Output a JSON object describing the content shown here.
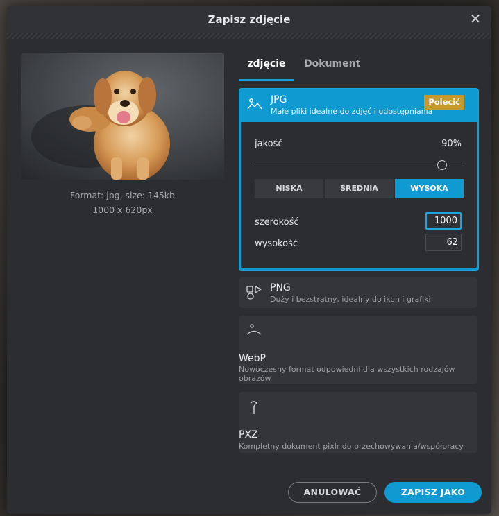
{
  "dialog": {
    "title": "Zapisz zdjęcie",
    "close_icon": "close-icon"
  },
  "preview": {
    "info_format": "Format: jpg, size: 145kb",
    "info_dimensions": "1000 x 620px"
  },
  "tabs": [
    {
      "label": "zdjęcie",
      "active": true
    },
    {
      "label": "Dokument",
      "active": false
    }
  ],
  "formats": {
    "jpg": {
      "name": "JPG",
      "description": "Małe pliki idealne do zdjęć i udostępniania",
      "badge": "Polecić",
      "icon": "landscape-icon",
      "selected": true
    },
    "png": {
      "name": "PNG",
      "description": "Duży i bezstratny, idealny do ikon i grafiki",
      "icon": "shapes-icon"
    },
    "webp": {
      "name": "WebP",
      "description": "Nowoczesny format odpowiedni dla wszystkich rodzajów obrazów",
      "icon": "webp-icon"
    },
    "pxz": {
      "name": "PXZ",
      "description": "Kompletny dokument pixlr do przechowywania/współpracy",
      "icon": "pen-icon"
    }
  },
  "quality": {
    "label": "jakość",
    "value_label": "90%",
    "value": 0.9
  },
  "quality_presets": [
    {
      "label": "NISKA",
      "active": false
    },
    {
      "label": "ŚREDNIA",
      "active": false
    },
    {
      "label": "WYSOKA",
      "active": true
    }
  ],
  "dimensions": {
    "width_label": "szerokość",
    "width_value": "1000",
    "height_label": "wysokość",
    "height_value": "62"
  },
  "actions": {
    "cancel_label": "ANULOWAĆ",
    "save_label": "ZAPISZ JAKO"
  },
  "colors": {
    "accent": "#0f9bd2",
    "badge": "#c39a2d",
    "panel": "#2b2d31"
  }
}
